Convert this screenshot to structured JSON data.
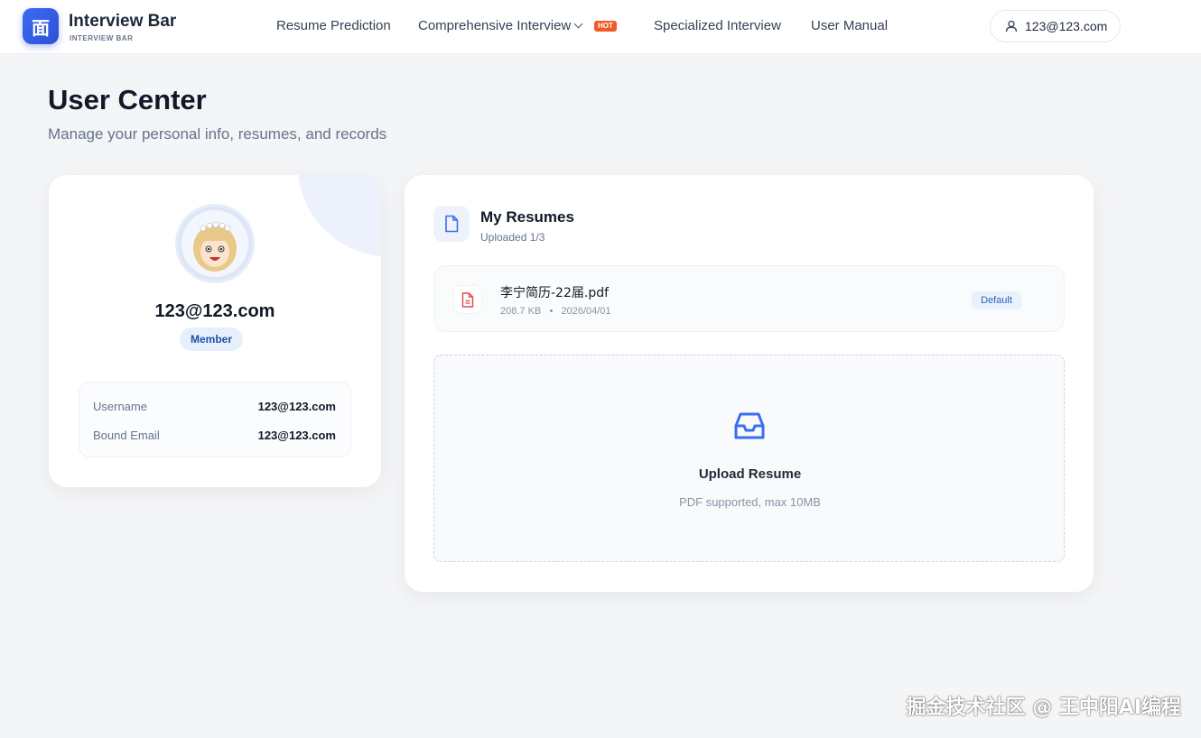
{
  "header": {
    "logo_glyph": "面",
    "brand_title": "Interview Bar",
    "brand_subtitle": "INTERVIEW BAR",
    "nav": [
      {
        "label": "Resume Prediction"
      },
      {
        "label": "Comprehensive Interview",
        "badge": "HOT"
      },
      {
        "label": "Specialized Interview"
      },
      {
        "label": "User Manual"
      }
    ],
    "user_email": "123@123.com"
  },
  "page": {
    "title": "User Center",
    "subtitle": "Manage your personal info, resumes, and records"
  },
  "profile": {
    "name": "123@123.com",
    "role_badge": "Member",
    "fields": [
      {
        "label": "Username",
        "value": "123@123.com"
      },
      {
        "label": "Bound Email",
        "value": "123@123.com"
      }
    ]
  },
  "resumes": {
    "title": "My Resumes",
    "count_text": "Uploaded 1/3",
    "files": [
      {
        "name": "李宁简历-22届.pdf",
        "size": "208.7 KB",
        "date": "2026/04/01",
        "badge": "Default"
      }
    ],
    "upload": {
      "title": "Upload Resume",
      "hint": "PDF supported, max 10MB"
    }
  },
  "watermark": "掘金技术社区 @ 王中阳AI编程",
  "colors": {
    "accent": "#3b6df0",
    "hot": "#f05a28",
    "pdf_red": "#e5484d"
  }
}
